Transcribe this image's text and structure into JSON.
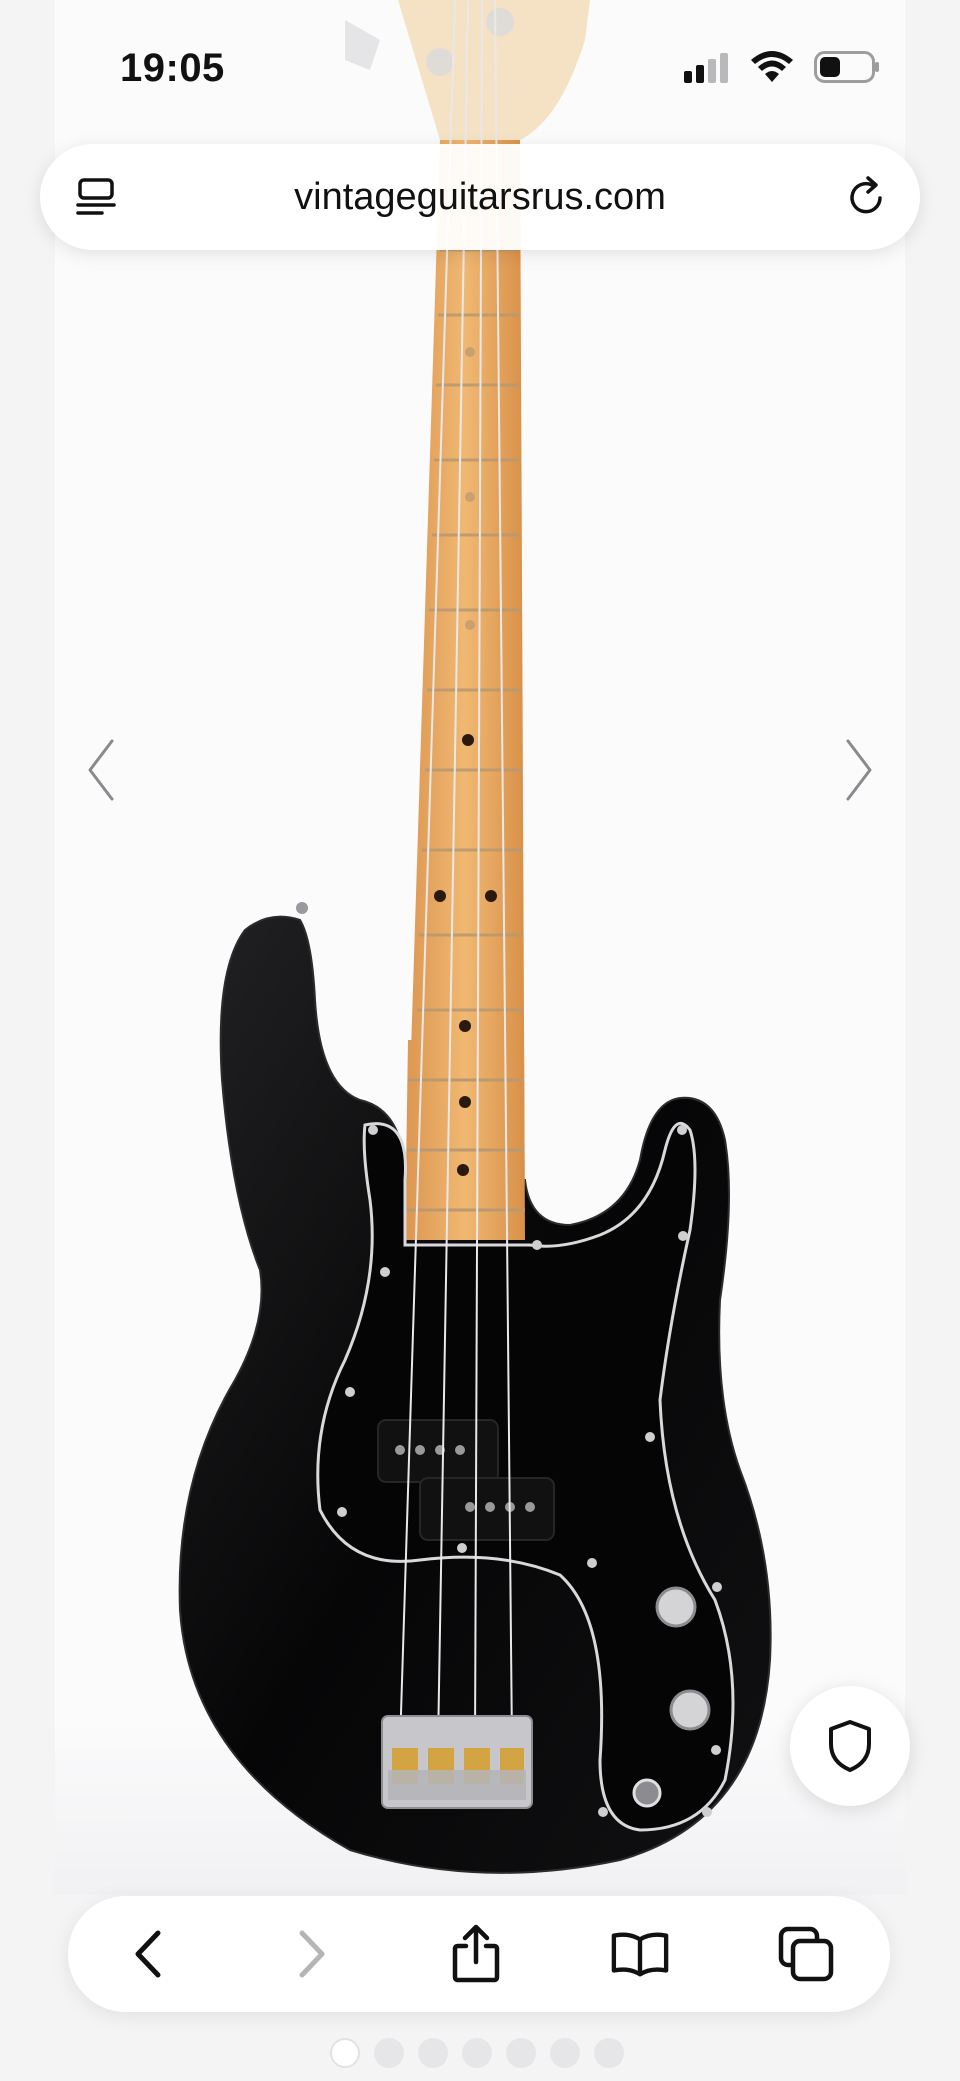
{
  "status_bar": {
    "time": "19:05",
    "icons": [
      "cellular-signal-icon",
      "wifi-icon",
      "battery-icon"
    ]
  },
  "browser": {
    "url": "vintageguitarsrus.com",
    "reader_icon": "reader-list-icon",
    "reload_icon": "reload-icon"
  },
  "gallery": {
    "image_subject": "black-bass-guitar",
    "prev_icon": "chevron-left-icon",
    "next_icon": "chevron-right-icon",
    "page_count": 7,
    "active_index": 0
  },
  "privacy_button": {
    "icon": "shield-icon"
  },
  "toolbar": {
    "items": [
      "back-icon",
      "forward-icon",
      "share-icon",
      "bookmarks-icon",
      "tabs-icon"
    ],
    "forward_enabled": false
  },
  "colors": {
    "accent": "#111111",
    "disabled": "#b5b5b8",
    "guitar_body": "#0c0c0d",
    "fretboard": "#e9a862"
  }
}
